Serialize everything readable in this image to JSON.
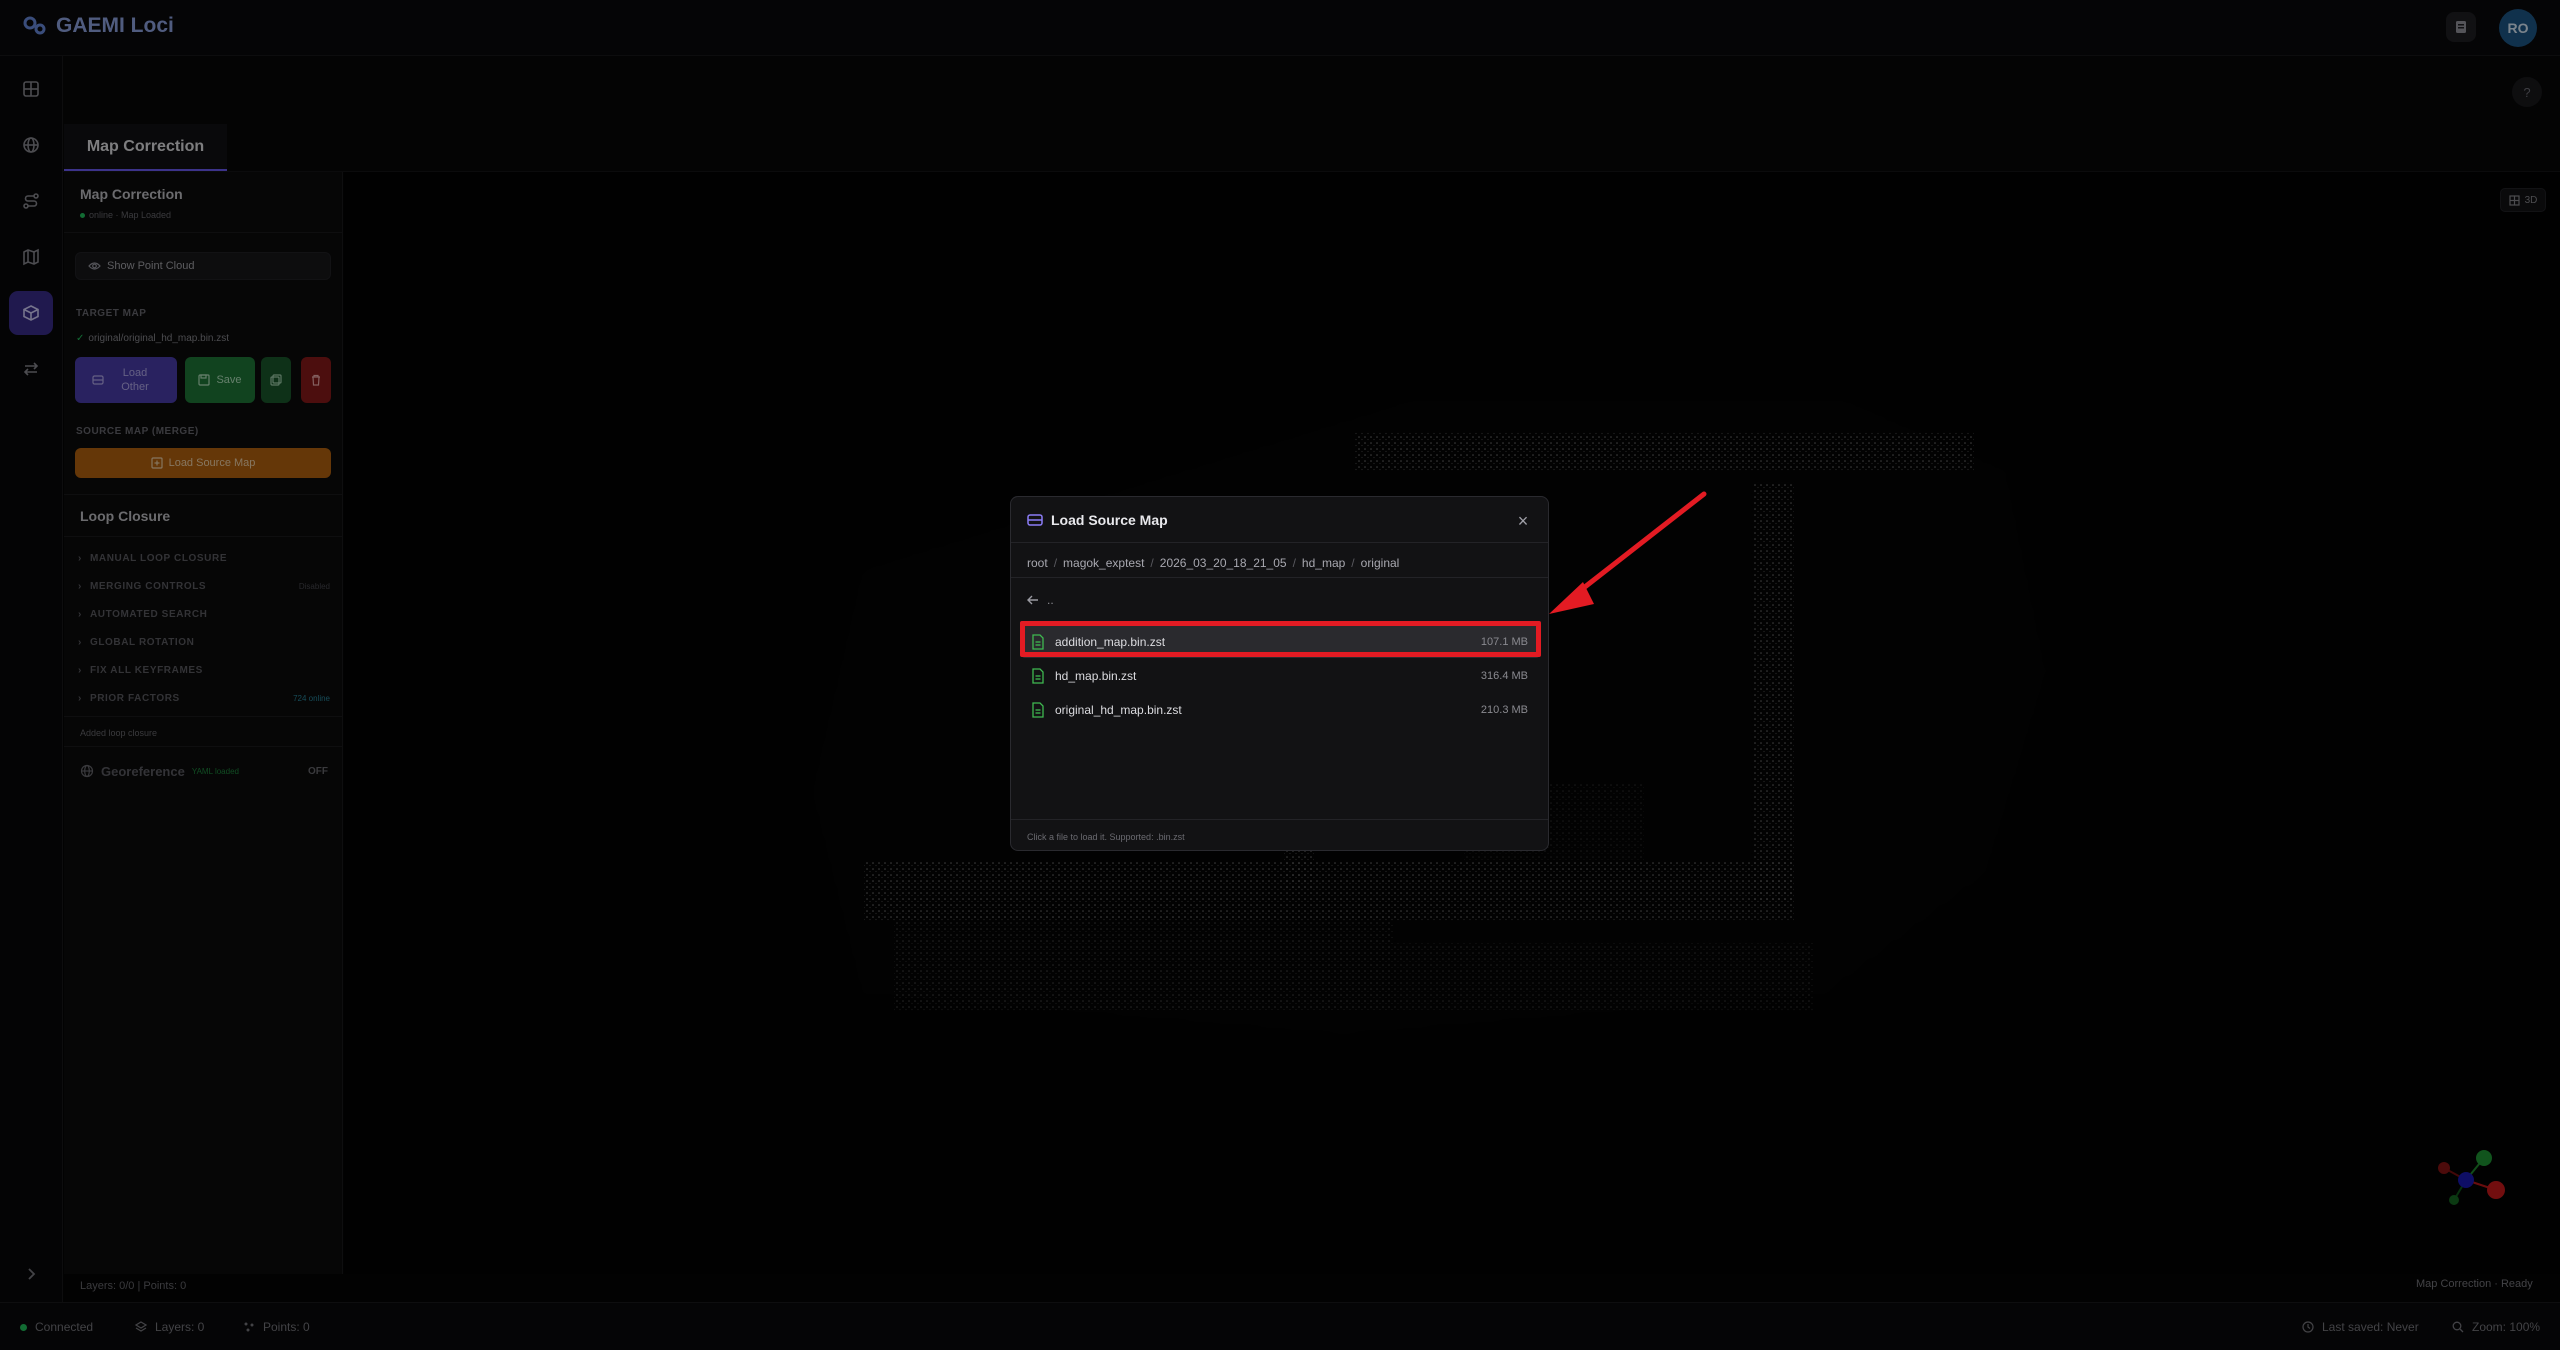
{
  "app": {
    "title": "GAEMI Loci",
    "avatar_initials": "RO"
  },
  "tabs": [
    {
      "label": "Map Correction"
    }
  ],
  "help_label": "?",
  "panel": {
    "title": "Map Correction",
    "status": "online · Map Loaded",
    "show_point_cloud": "Show Point Cloud",
    "target_map_label": "TARGET MAP",
    "target_map_file": "original/original_hd_map.bin.zst",
    "load_other_label": "Load Other",
    "save_label": "Save",
    "source_map_label": "SOURCE MAP (MERGE)",
    "load_source_label": "Load Source Map",
    "loop_closure_title": "Loop Closure",
    "accordion": [
      {
        "label": "MANUAL LOOP CLOSURE",
        "right": ""
      },
      {
        "label": "MERGING CONTROLS",
        "right": "Disabled"
      },
      {
        "label": "AUTOMATED SEARCH",
        "right": ""
      },
      {
        "label": "GLOBAL ROTATION",
        "right": ""
      },
      {
        "label": "FIX ALL KEYFRAMES",
        "right": ""
      },
      {
        "label": "PRIOR FACTORS",
        "right": "724 online"
      }
    ],
    "added_loop_closure": "Added loop closure",
    "georeference_title": "Georeference",
    "georeference_badge": "YAML loaded",
    "georeference_state": "OFF",
    "layers_points": "Layers: 0/0 | Points: 0"
  },
  "viewport": {
    "mode_button": "3D",
    "status_text": "Map Correction · Ready"
  },
  "statusbar": {
    "connection": "Connected",
    "layers": "Layers: 0",
    "points": "Points: 0",
    "last_saved": "Last saved: Never",
    "zoom": "Zoom: 100%"
  },
  "modal": {
    "title": "Load Source Map",
    "breadcrumb": [
      "root",
      "magok_exptest",
      "2026_03_20_18_21_05",
      "hd_map",
      "original"
    ],
    "back_label": "..",
    "files": [
      {
        "name": "addition_map.bin.zst",
        "size": "107.1 MB"
      },
      {
        "name": "hd_map.bin.zst",
        "size": "316.4 MB"
      },
      {
        "name": "original_hd_map.bin.zst",
        "size": "210.3 MB"
      }
    ],
    "footer": "Click a file to load it. Supported: .bin.zst"
  },
  "colors": {
    "accent": "#6d5dfc",
    "save_green": "#1f7a3a",
    "load_source_orange": "#b8650f",
    "danger_red": "#8b1a1a",
    "highlight_red": "#e31b23",
    "file_icon_green": "#3fb950",
    "connected_green": "#22c55e"
  },
  "icons": {
    "logo": "gear-pair-icon",
    "rail": [
      "grid-icon",
      "globe-icon",
      "route-icon",
      "map-icon",
      "cube-icon",
      "swap-icon",
      "chevron-right-icon"
    ]
  }
}
